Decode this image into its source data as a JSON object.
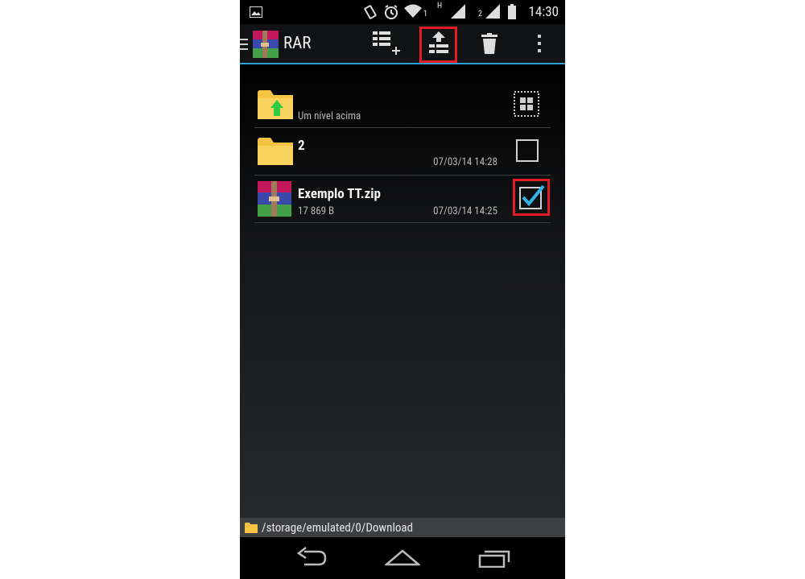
{
  "status_bar": {
    "sim1": "1",
    "network": "H",
    "sim2": "2",
    "time": "14:30"
  },
  "action_bar": {
    "title": "RAR",
    "icons": [
      "menu-drawer-icon",
      "rar-logo-icon",
      "add-to-archive-icon",
      "extract-icon",
      "delete-icon",
      "overflow-menu-icon"
    ]
  },
  "file_list": {
    "up_item": {
      "label": "Um nível acima"
    },
    "items": [
      {
        "name": "2",
        "size": "",
        "date": "07/03/14 14:28",
        "type": "folder",
        "checked": false
      },
      {
        "name": "Exemplo TT.zip",
        "size": "17 869 B",
        "date": "07/03/14 14:25",
        "type": "archive",
        "checked": true
      }
    ]
  },
  "path_bar": {
    "path": "/storage/emulated/0/Download"
  },
  "nav_bar": {
    "icons": [
      "back-icon",
      "home-icon",
      "recents-icon"
    ]
  },
  "colors": {
    "accent": "#2f9fd6",
    "highlight": "#e31b23",
    "folder": "#f5c342"
  }
}
